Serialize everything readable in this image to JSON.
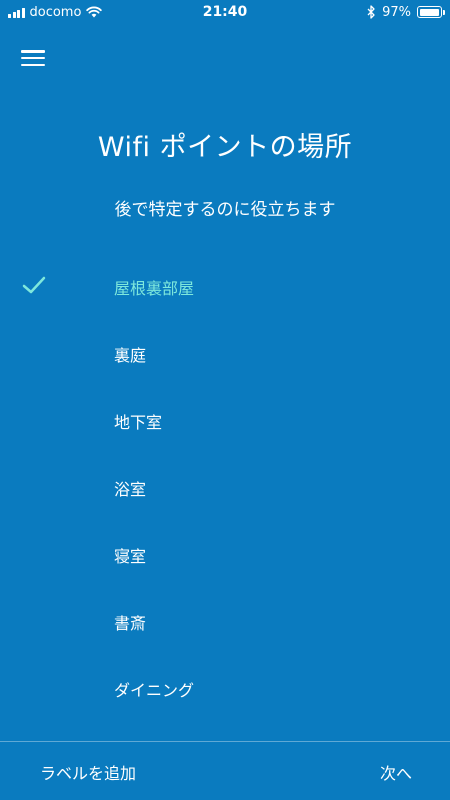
{
  "status_bar": {
    "carrier": "docomo",
    "time": "21:40",
    "battery_percent": "97%",
    "battery_level": 0.97,
    "icons": [
      "signal-icon",
      "wifi-icon",
      "bluetooth-icon",
      "battery-icon"
    ]
  },
  "header": {
    "menu_icon": "hamburger-menu-icon",
    "title": "Wifi ポイントの場所",
    "subtitle": "後で特定するのに役立ちます"
  },
  "locations": {
    "selected_index": 0,
    "accent_color": "#7ee8dc",
    "items": [
      {
        "label": "屋根裏部屋"
      },
      {
        "label": "裏庭"
      },
      {
        "label": "地下室"
      },
      {
        "label": "浴室"
      },
      {
        "label": "寝室"
      },
      {
        "label": "書斎"
      },
      {
        "label": "ダイニング"
      }
    ]
  },
  "footer": {
    "add_label": "ラベルを追加",
    "next": "次へ"
  },
  "colors": {
    "background": "#0a7bbf",
    "text": "#ffffff"
  }
}
